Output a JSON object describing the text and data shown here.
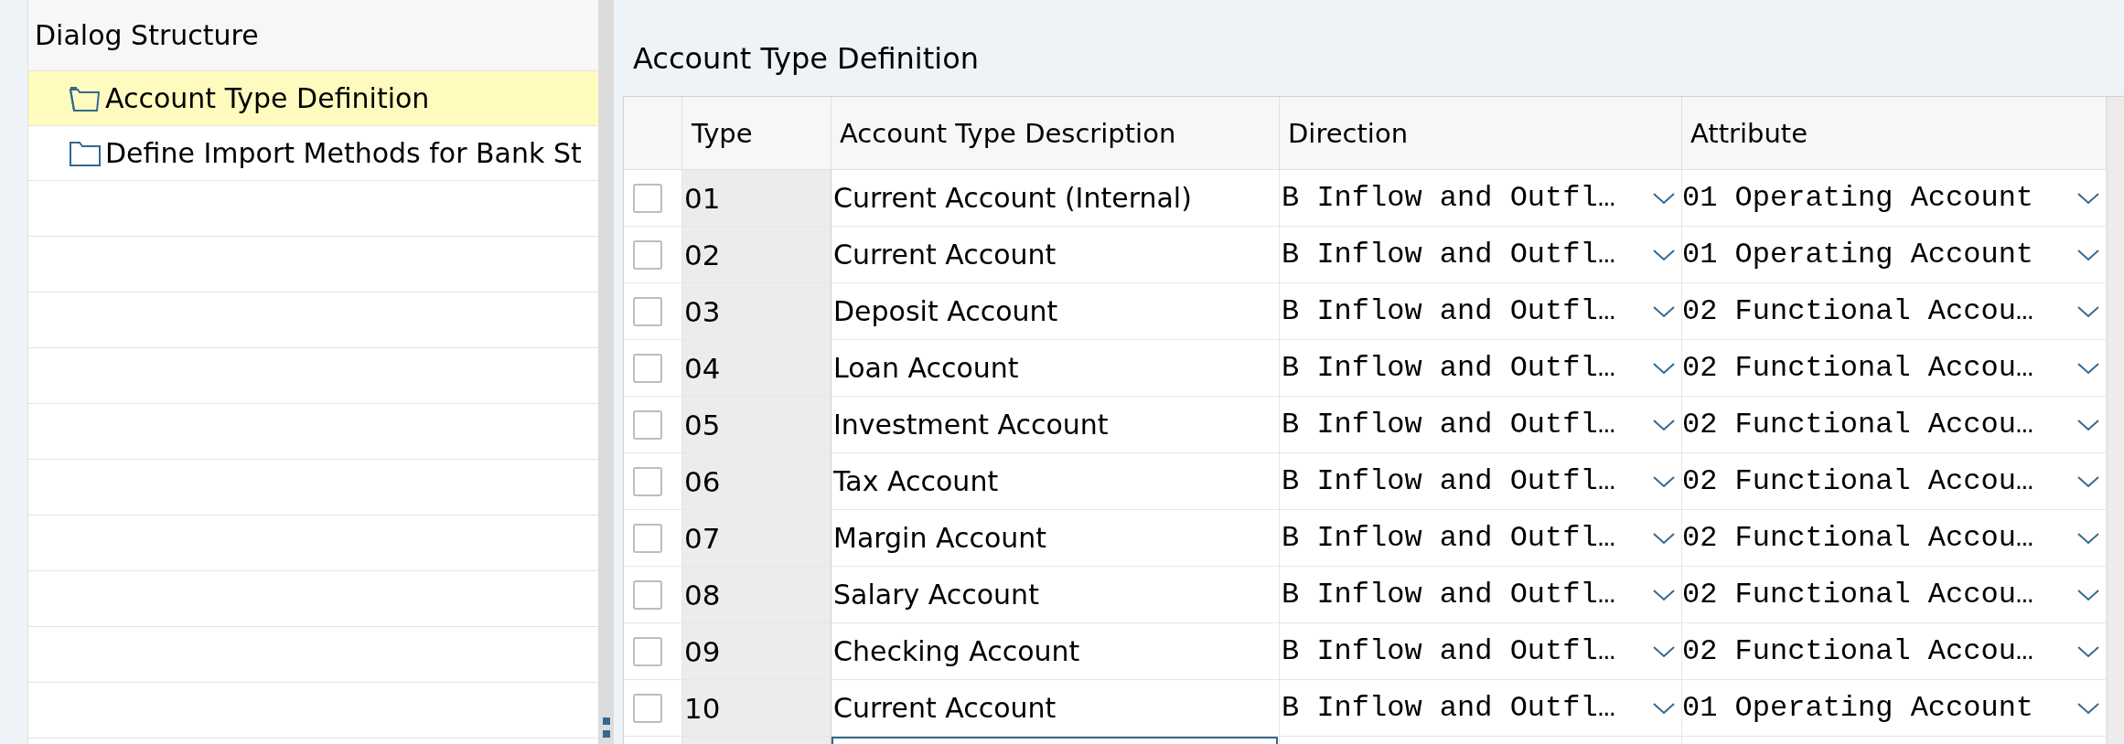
{
  "dialog_structure": {
    "title": "Dialog Structure",
    "items": [
      {
        "label": "Account Type Definition",
        "selected": true
      },
      {
        "label": "Define Import Methods for Bank St",
        "selected": false
      }
    ]
  },
  "content": {
    "title": "Account Type Definition",
    "table": {
      "columns": [
        "Type",
        "Account Type Description",
        "Direction",
        "Attribute"
      ],
      "rows": [
        {
          "selected": false,
          "type": "01",
          "description": "Current Account (Internal)",
          "direction": "B Inflow and Outfl…",
          "attribute": "01 Operating Account"
        },
        {
          "selected": false,
          "type": "02",
          "description": "Current Account",
          "direction": "B Inflow and Outfl…",
          "attribute": "01 Operating Account"
        },
        {
          "selected": false,
          "type": "03",
          "description": "Deposit Account",
          "direction": "B Inflow and Outfl…",
          "attribute": "02 Functional Accou…"
        },
        {
          "selected": false,
          "type": "04",
          "description": "Loan Account",
          "direction": "B Inflow and Outfl…",
          "attribute": "02 Functional Accou…"
        },
        {
          "selected": false,
          "type": "05",
          "description": "Investment Account",
          "direction": "B Inflow and Outfl…",
          "attribute": "02 Functional Accou…"
        },
        {
          "selected": false,
          "type": "06",
          "description": "Tax Account",
          "direction": "B Inflow and Outfl…",
          "attribute": "02 Functional Accou…"
        },
        {
          "selected": false,
          "type": "07",
          "description": "Margin Account",
          "direction": "B Inflow and Outfl…",
          "attribute": "02 Functional Accou…"
        },
        {
          "selected": false,
          "type": "08",
          "description": "Salary Account",
          "direction": "B Inflow and Outfl…",
          "attribute": "02 Functional Accou…"
        },
        {
          "selected": false,
          "type": "09",
          "description": "Checking Account",
          "direction": "B Inflow and Outfl…",
          "attribute": "02 Functional Accou…"
        },
        {
          "selected": false,
          "type": "10",
          "description": "Current Account",
          "direction": "B Inflow and Outfl…",
          "attribute": "01 Operating Account"
        }
      ]
    }
  }
}
